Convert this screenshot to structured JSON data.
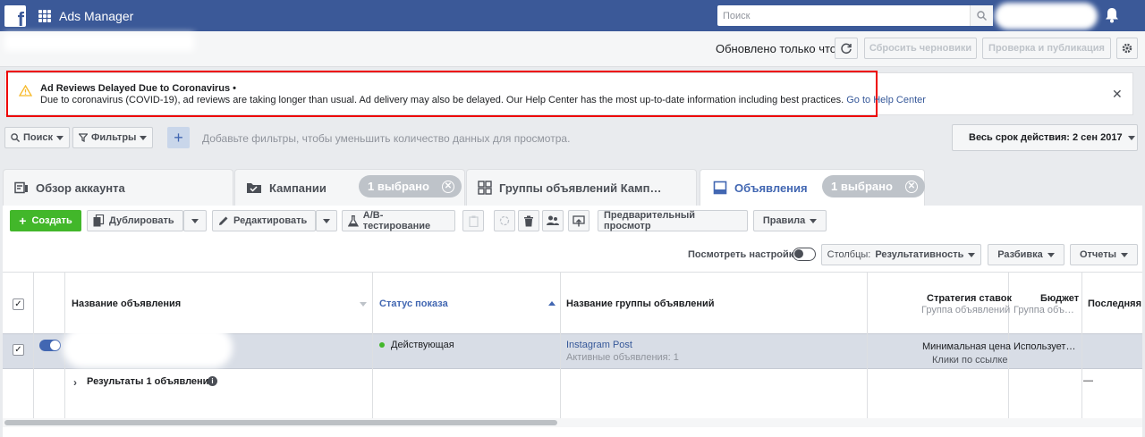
{
  "topbar": {
    "app_title": "Ads Manager",
    "search_placeholder": "Поиск",
    "logo_letter": "f"
  },
  "subbar": {
    "updated_text": "Обновлено только что",
    "reset_drafts": "Сбросить черновики",
    "review_publish": "Проверка и публикация"
  },
  "alert": {
    "title": "Ad Reviews Delayed Due to Coronavirus •",
    "text": "Due to coronavirus (COVID-19), ad reviews are taking longer than usual. Ad delivery may also be delayed. Our Help Center has the most up-to-date information including best practices.",
    "link": "Go to Help Center",
    "close": "✕"
  },
  "filters": {
    "search": "Поиск",
    "filters": "Фильтры",
    "hint": "Добавьте фильтры, чтобы уменьшить количество данных для просмотра.",
    "date_range": "Весь срок действия: 2 сен 2017"
  },
  "tabs": {
    "account": "Обзор аккаунта",
    "campaigns": "Кампании",
    "campaigns_selected": "1 выбрано",
    "adsets": "Группы объявлений Камп…",
    "ads": "Объявления",
    "ads_selected": "1 выбрано"
  },
  "toolbar": {
    "create": "Создать",
    "duplicate": "Дублировать",
    "edit": "Редактировать",
    "ab_test": "A/B-тестирование",
    "preview": "Предварительный просмотр",
    "rules": "Правила",
    "view_settings": "Посмотреть настройки",
    "columns_label": "Столбцы:",
    "columns_value": "Результативность",
    "breakdown": "Разбивка",
    "reports": "Отчеты"
  },
  "table": {
    "headers": {
      "ad_name": "Название объявления",
      "delivery": "Статус показа",
      "adset_name": "Название группы объявлений",
      "bid_strategy": "Стратегия ставок",
      "bid_strategy_sub": "Группа объявлений",
      "budget": "Бюджет",
      "budget_sub": "Группа объ…",
      "last": "Последняя"
    },
    "row": {
      "delivery": "Действующая",
      "adset_name": "Instagram Post",
      "adset_sub": "Активные объявления: 1",
      "bid_strategy": "Минимальная цена",
      "bid_strategy_sub": "Клики по ссылке",
      "budget": "Использует…"
    },
    "summary": {
      "label": "Результаты 1 объявления",
      "last": "—"
    }
  },
  "colors": {
    "topbar": "#3b5998",
    "accent": "#4267b2",
    "create": "#42b72a",
    "alert_border": "#e00000"
  }
}
